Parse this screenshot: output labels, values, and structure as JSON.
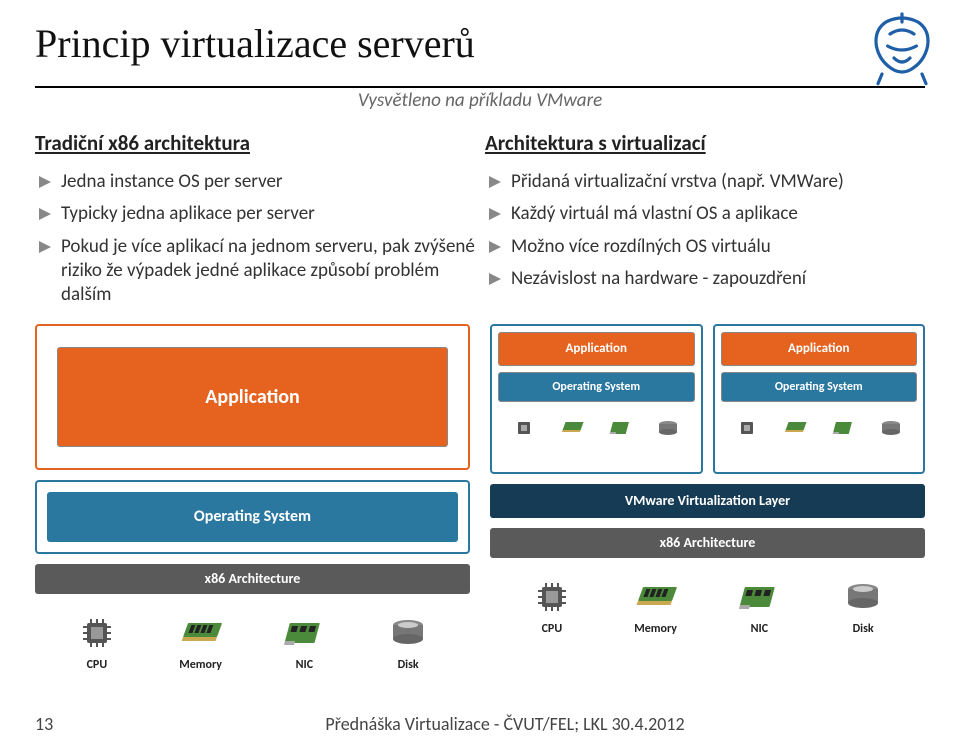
{
  "title": "Princip virtualizace serverů",
  "subtitle": "Vysvětleno na příkladu VMware",
  "left": {
    "heading": "Tradiční x86 architektura",
    "bullets": [
      "Jedna instance OS per server",
      "Typicky jedna aplikace per server",
      "Pokud je více aplikací na jednom serveru, pak zvýšené riziko že výpadek jedné aplikace způsobí problém dalším"
    ]
  },
  "right": {
    "heading": "Architektura s virtualizací",
    "bullets": [
      "Přidaná virtualizační vrstva (např. VMWare)",
      "Každý virtuál má vlastní OS a aplikace",
      "Možno více rozdílných OS virtuálu",
      "Nezávislost na hardware - zapouzdření"
    ]
  },
  "diagram": {
    "application": "Application",
    "os": "Operating System",
    "x86": "x86 Architecture",
    "vmlayer": "VMware Virtualization Layer",
    "hw": {
      "cpu": "CPU",
      "memory": "Memory",
      "nic": "NIC",
      "disk": "Disk"
    }
  },
  "footer": {
    "page": "13",
    "text": "Přednáška Virtualizace - ČVUT/FEL;   LKL   30.4.2012"
  }
}
